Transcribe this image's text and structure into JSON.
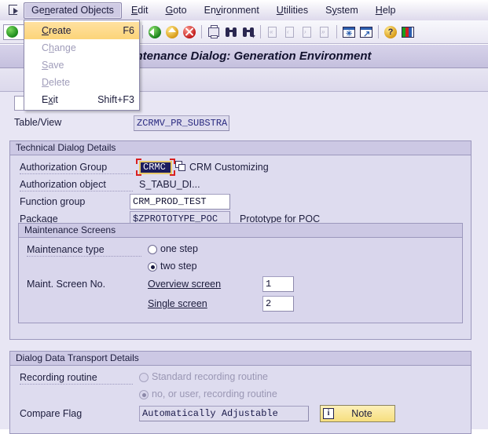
{
  "window": {
    "title": "aintenance Dialog: Generation Environment",
    "full_title_hint": "Maintenance Dialog: Generation Environment"
  },
  "menubar": {
    "system_menu_icon": "system-menu-icon",
    "items": [
      {
        "label": "Generated Objects",
        "accel": "n",
        "open": true
      },
      {
        "label": "Edit",
        "accel": "E",
        "open": false
      },
      {
        "label": "Goto",
        "accel": "G",
        "open": false
      },
      {
        "label": "Environment",
        "accel": "v",
        "open": false
      },
      {
        "label": "Utilities",
        "accel": "U",
        "open": false
      },
      {
        "label": "System",
        "accel": "y",
        "open": false
      },
      {
        "label": "Help",
        "accel": "H",
        "open": false
      }
    ]
  },
  "dropdown": {
    "items": [
      {
        "label": "Create",
        "accel": "C",
        "shortcut": "F6",
        "state": "highlighted"
      },
      {
        "label": "Change",
        "accel": "h",
        "shortcut": "",
        "state": "disabled"
      },
      {
        "label": "Save",
        "accel": "S",
        "shortcut": "",
        "state": "disabled"
      },
      {
        "label": "Delete",
        "accel": "D",
        "shortcut": "",
        "state": "disabled"
      },
      {
        "label": "Exit",
        "accel": "x",
        "shortcut": "Shift+F3",
        "state": "enabled"
      }
    ]
  },
  "toolbar": {
    "command_field_value": "",
    "buttons": [
      {
        "name": "enter-button",
        "enabled": true
      },
      {
        "name": "command-dropdown-arrow",
        "enabled": true
      },
      {
        "name": "back-triangle-icon",
        "enabled": true
      },
      {
        "name": "save-icon",
        "enabled": true
      },
      {
        "name": "back-green-icon",
        "enabled": true
      },
      {
        "name": "exit-yellow-icon",
        "enabled": true
      },
      {
        "name": "cancel-red-icon",
        "enabled": true
      },
      {
        "name": "print-icon",
        "enabled": true
      },
      {
        "name": "find-icon",
        "enabled": true
      },
      {
        "name": "find-next-icon",
        "enabled": true
      },
      {
        "name": "first-page-icon",
        "enabled": false
      },
      {
        "name": "previous-page-icon",
        "enabled": false
      },
      {
        "name": "next-page-icon",
        "enabled": false
      },
      {
        "name": "last-page-icon",
        "enabled": false
      },
      {
        "name": "create-session-icon",
        "enabled": true
      },
      {
        "name": "create-shortcut-icon",
        "enabled": true
      },
      {
        "name": "help-icon",
        "enabled": true
      },
      {
        "name": "customize-layout-icon",
        "enabled": true
      }
    ]
  },
  "form": {
    "table_view": {
      "label": "Table/View",
      "value": "ZCRMV_PR_SUBSTRA"
    },
    "technical": {
      "group_title": "Technical Dialog Details",
      "auth_group": {
        "label": "Authorization Group",
        "value": "CRMC",
        "description": "CRM Customizing",
        "focused": true
      },
      "auth_object": {
        "label": "Authorization object",
        "value": "S_TABU_DI..."
      },
      "function_group": {
        "label": "Function group",
        "value": "CRM_PROD_TEST"
      },
      "package": {
        "label": "Package",
        "value": "$ZPROTOTYPE_POC",
        "description": "Prototype for POC"
      }
    },
    "maintenance": {
      "group_title": "Maintenance Screens",
      "type_label": "Maintenance type",
      "options": [
        {
          "label": "one step",
          "selected": false
        },
        {
          "label": "two step",
          "selected": true
        }
      ],
      "screen_no_label": "Maint. Screen No.",
      "screens": [
        {
          "label": "Overview screen",
          "value": "1"
        },
        {
          "label": "Single screen",
          "value": "2"
        }
      ]
    },
    "transport": {
      "group_title": "Dialog Data Transport Details",
      "recording_label": "Recording routine",
      "recording_options": [
        {
          "label": "Standard recording routine",
          "selected": false,
          "disabled": true
        },
        {
          "label": "no, or user, recording routine",
          "selected": true,
          "disabled": true
        }
      ],
      "compare_flag": {
        "label": "Compare Flag",
        "value": "Automatically Adjustable"
      },
      "note_button": {
        "label": "Note",
        "icon": "info-icon"
      }
    }
  },
  "colors": {
    "canvas": "#e8e6f4",
    "group_bg": "#dedcef",
    "group_header": "#ccc8e4",
    "title_bar": "#cfcae3",
    "menu_highlight": "#fcd479",
    "focus_red": "#d82020",
    "selection_navy": "#1c1c5e",
    "note_yellow": "#f6de7e",
    "field_text_blue": "#2a2a80"
  }
}
